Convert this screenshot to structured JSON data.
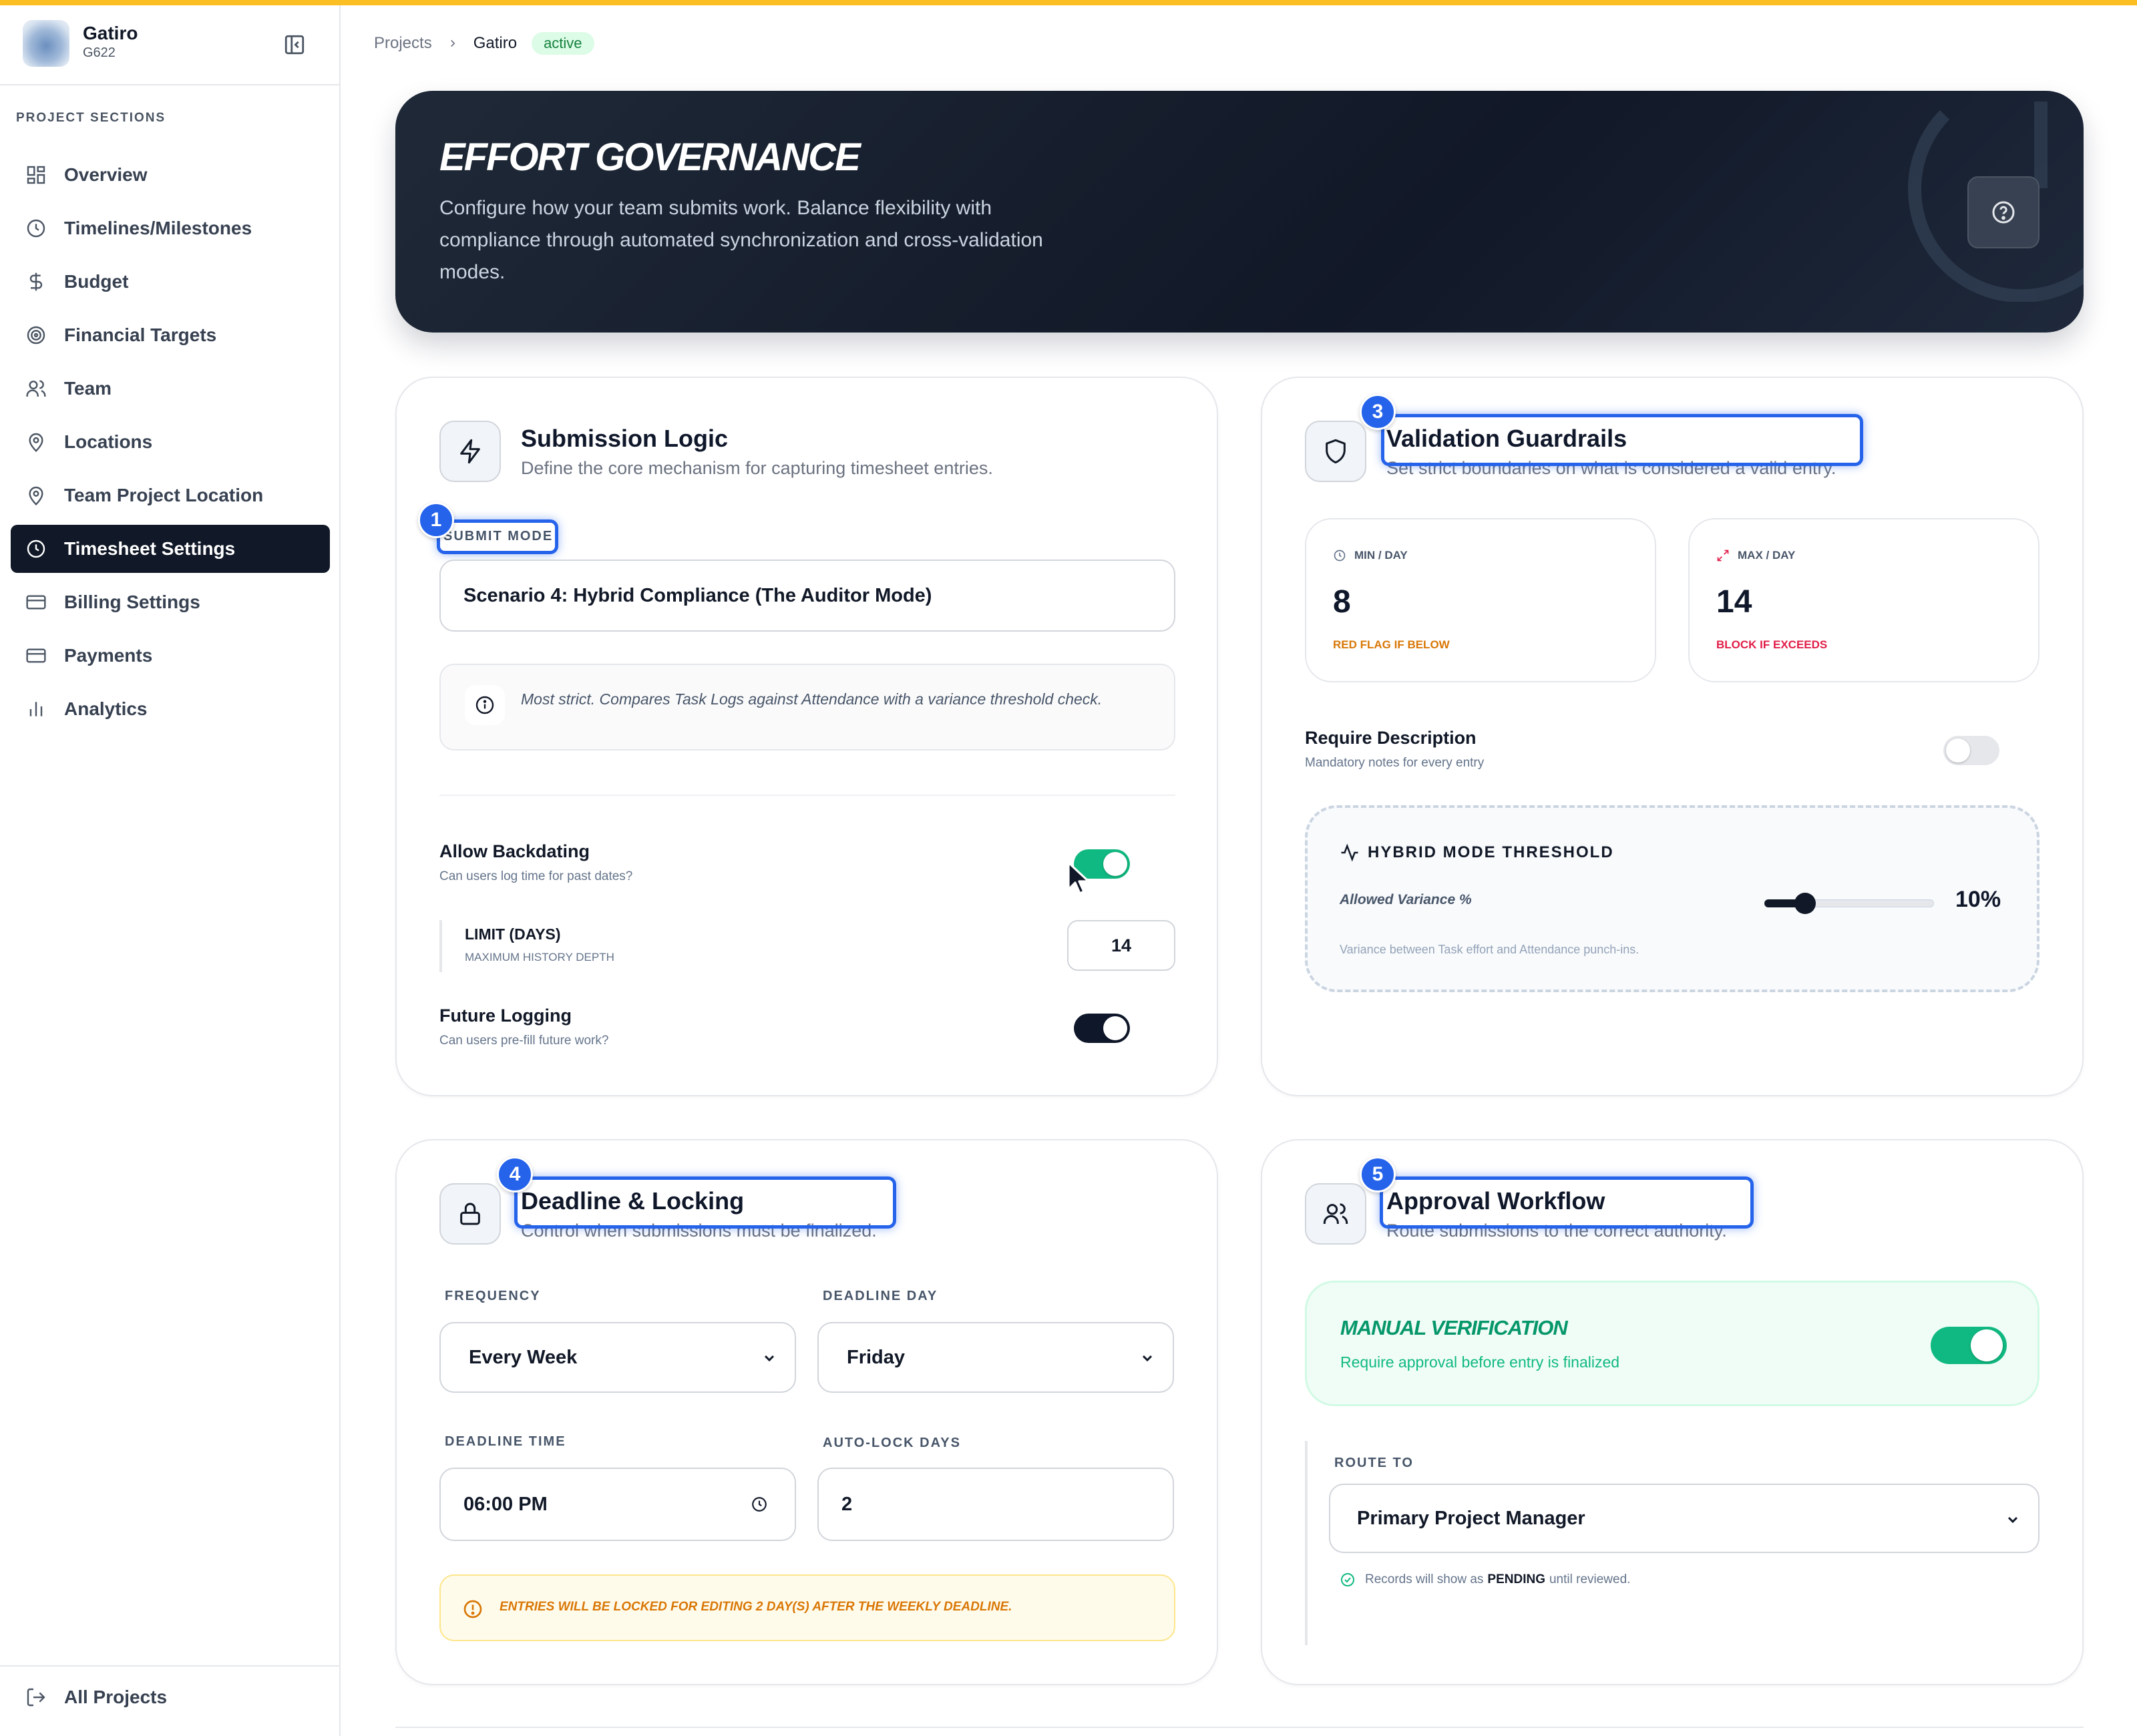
{
  "sidebar": {
    "project_name": "Gatiro",
    "project_code": "G622",
    "section_label": "PROJECT SECTIONS",
    "items": [
      {
        "label": "Overview",
        "icon": "grid-icon"
      },
      {
        "label": "Timelines/Milestones",
        "icon": "clock-icon"
      },
      {
        "label": "Budget",
        "icon": "dollar-icon"
      },
      {
        "label": "Financial Targets",
        "icon": "target-icon"
      },
      {
        "label": "Team",
        "icon": "users-icon"
      },
      {
        "label": "Locations",
        "icon": "map-pin-icon"
      },
      {
        "label": "Team Project Location",
        "icon": "map-pin-icon"
      },
      {
        "label": "Timesheet Settings",
        "icon": "clock-icon",
        "active": true
      },
      {
        "label": "Billing Settings",
        "icon": "credit-card-icon"
      },
      {
        "label": "Payments",
        "icon": "credit-card-icon"
      },
      {
        "label": "Analytics",
        "icon": "bar-chart-icon"
      }
    ],
    "footer_label": "All Projects"
  },
  "breadcrumb": {
    "root": "Projects",
    "current": "Gatiro",
    "status": "active"
  },
  "hero": {
    "title": "EFFORT GOVERNANCE",
    "description": "Configure how your team submits work. Balance flexibility with compliance through automated synchronization and cross-validation modes."
  },
  "submission": {
    "marker": "1",
    "title": "Submission Logic",
    "subtitle": "Define the core mechanism for capturing timesheet entries.",
    "mode_label": "SUBMIT MODE",
    "mode_value": "Scenario 4: Hybrid Compliance (The Auditor Mode)",
    "mode_info": "Most strict. Compares Task Logs against Attendance with a variance threshold check.",
    "backdating_title": "Allow Backdating",
    "backdating_sub": "Can users log time for past dates?",
    "backdating_on": true,
    "limit_title": "LIMIT (DAYS)",
    "limit_sub": "MAXIMUM HISTORY DEPTH",
    "limit_value": "14",
    "future_title": "Future Logging",
    "future_sub": "Can users pre-fill future work?",
    "future_on": true
  },
  "validation": {
    "marker": "3",
    "title": "Validation Guardrails",
    "subtitle": "Set strict boundaries on what is considered a valid entry.",
    "min_label": "MIN / DAY",
    "min_value": "8",
    "min_note": "RED FLAG IF BELOW",
    "max_label": "MAX / DAY",
    "max_value": "14",
    "max_note": "BLOCK IF EXCEEDS",
    "desc_title": "Require Description",
    "desc_sub": "Mandatory notes for every entry",
    "desc_on": false,
    "threshold_title": "HYBRID MODE THRESHOLD",
    "variance_label": "Allowed Variance %",
    "variance_value": "10%",
    "variance_fraction": 0.24,
    "threshold_note": "Variance between Task effort and Attendance punch-ins."
  },
  "deadline": {
    "marker": "4",
    "title": "Deadline & Locking",
    "subtitle": "Control when submissions must be finalized.",
    "frequency_label": "FREQUENCY",
    "frequency_value": "Every Week",
    "day_label": "DEADLINE DAY",
    "day_value": "Friday",
    "time_label": "DEADLINE TIME",
    "time_value": "06:00 PM",
    "autolock_label": "AUTO-LOCK DAYS",
    "autolock_value": "2",
    "warning": "ENTRIES WILL BE LOCKED FOR EDITING 2 DAY(S) AFTER THE WEEKLY DEADLINE."
  },
  "approval": {
    "marker": "5",
    "title": "Approval Workflow",
    "subtitle": "Route submissions to the correct authority.",
    "manual_title": "MANUAL VERIFICATION",
    "manual_sub": "Require approval before entry is finalized",
    "manual_on": true,
    "route_label": "ROUTE TO",
    "route_value": "Primary Project Manager",
    "note_pre": "Records will show as",
    "note_bold": "PENDING",
    "note_post": "until reviewed."
  },
  "colors": {
    "accent_yellow": "#fbbf24",
    "active_nav": "#111827",
    "toggle_green": "#10b981",
    "marker_blue": "#2563eb",
    "flag_orange": "#d97706",
    "block_red": "#e11d48"
  }
}
